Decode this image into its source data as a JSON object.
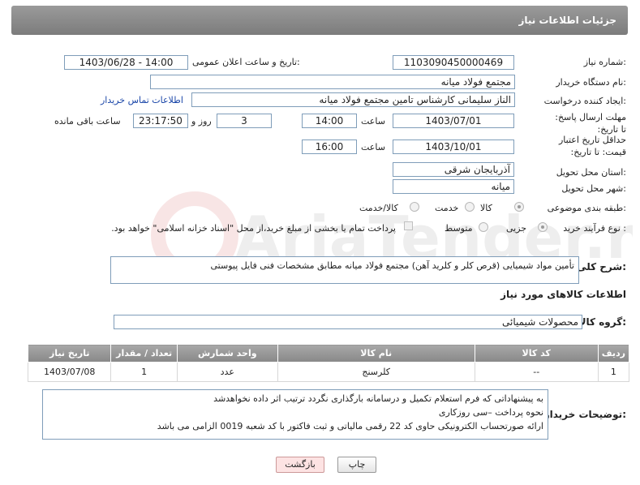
{
  "header": {
    "title": "جزئیات اطلاعات نیاز"
  },
  "form": {
    "need_number_label": "شماره نیاز:",
    "need_number": "1103090450000469",
    "announce_label": "تاریخ و ساعت اعلان عمومی:",
    "announce_value": "1403/06/28 - 14:00",
    "buyer_org_label": "نام دستگاه خریدار:",
    "buyer_org": "مجتمع فولاد میانه",
    "creator_label": "ایجاد کننده درخواست:",
    "creator": "الناز سلیمانی کارشناس تامین مجتمع فولاد میانه",
    "contact_link": "اطلاعات تماس خریدار",
    "deadline_label": "مهلت ارسال پاسخ: تا تاریخ:",
    "deadline_date": "1403/07/01",
    "time_label": "ساعت",
    "deadline_time": "14:00",
    "days_value": "3",
    "days_label": "روز و",
    "remaining_time": "23:17:50",
    "remaining_label": "ساعت باقی مانده",
    "price_validity_label": "حداقل تاریخ اعتبار قیمت: تا تاریخ:",
    "price_validity_date": "1403/10/01",
    "price_validity_time": "16:00",
    "province_label": "استان محل تحویل:",
    "province": "آذربایجان شرقی",
    "city_label": "شهر محل تحویل:",
    "city": "میانه",
    "category_label": "طبقه بندی موضوعی:",
    "category_options": [
      "کالا",
      "خدمت",
      "کالا/خدمت"
    ],
    "process_label": "نوع فرآیند خرید :",
    "process_options": [
      "جزیی",
      "متوسط"
    ],
    "payment_note": "پرداخت تمام یا بخشی از مبلغ خرید،از محل \"اسناد خزانه اسلامی\" خواهد بود."
  },
  "description": {
    "label": "شرح کلی نیاز:",
    "text": "تأمین مواد شیمیایی (قرص کلر و کلرید آهن) مجتمع فولاد میانه مطابق مشخصات فنی فایل پیوستی"
  },
  "goods": {
    "section_title": "اطلاعات کالاهای مورد نیاز",
    "group_label": "گروه کالا:",
    "group_value": "محصولات شیمیائی",
    "columns": [
      "ردیف",
      "کد کالا",
      "نام کالا",
      "واحد شمارش",
      "تعداد / مقدار",
      "تاریخ نیاز"
    ],
    "rows": [
      [
        "1",
        "--",
        "کلرسنج",
        "عدد",
        "1",
        "1403/07/08"
      ]
    ]
  },
  "buyer_notes": {
    "label": "توضیحات خریدار:",
    "lines": [
      "به پیشنهاداتی که فرم استعلام تکمیل و درسامانه بارگذاری نگردد ترتیب اثر داده نخواهدشد",
      "نحوه پرداخت –سی روزکاری",
      "ارائه صورتحساب الکترونیکی حاوی کد 22 رقمی مالیاتی و ثبت فاکتور با کد شعبه 0019 الزامی می باشد"
    ]
  },
  "buttons": {
    "print": "چاپ",
    "back": "بازگشت"
  },
  "watermark": "AriaTender.net"
}
